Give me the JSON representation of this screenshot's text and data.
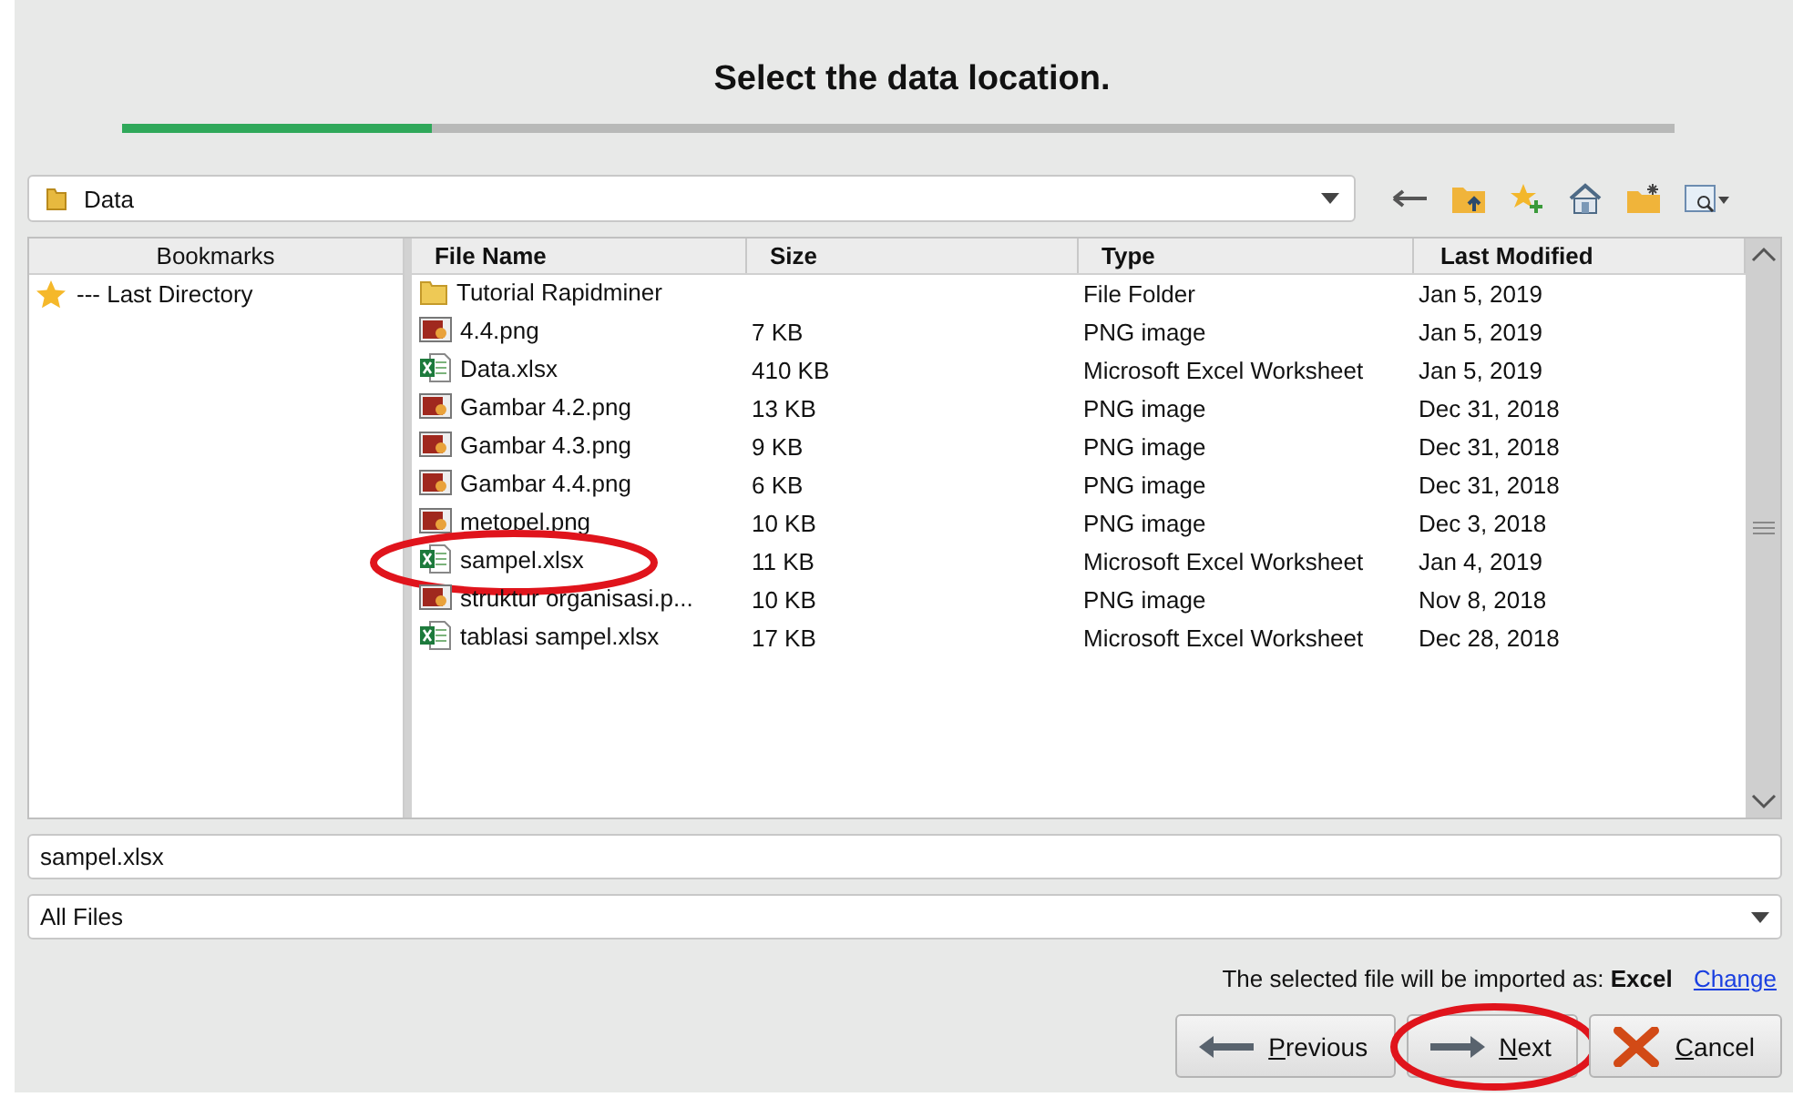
{
  "heading": "Select the data location.",
  "progress": {
    "level": 0.2
  },
  "location": {
    "value": "Data"
  },
  "bookmarks": {
    "header": "Bookmarks",
    "items": [
      {
        "label": "--- Last Directory"
      }
    ]
  },
  "files": {
    "columns": [
      "File Name",
      "Size",
      "Type",
      "Last Modified"
    ],
    "rows": [
      {
        "kind": "folder",
        "name": "Tutorial Rapidminer",
        "size": "",
        "type": "File Folder",
        "modified": "Jan 5, 2019",
        "circled": false
      },
      {
        "kind": "image",
        "name": "4.4.png",
        "size": "7 KB",
        "type": "PNG image",
        "modified": "Jan 5, 2019",
        "circled": false
      },
      {
        "kind": "excel",
        "name": "Data.xlsx",
        "size": "410 KB",
        "type": "Microsoft Excel Worksheet",
        "modified": "Jan 5, 2019",
        "circled": false
      },
      {
        "kind": "image",
        "name": "Gambar 4.2.png",
        "size": "13 KB",
        "type": "PNG image",
        "modified": "Dec 31, 2018",
        "circled": false
      },
      {
        "kind": "image",
        "name": "Gambar 4.3.png",
        "size": "9 KB",
        "type": "PNG image",
        "modified": "Dec 31, 2018",
        "circled": false
      },
      {
        "kind": "image",
        "name": "Gambar 4.4.png",
        "size": "6 KB",
        "type": "PNG image",
        "modified": "Dec 31, 2018",
        "circled": false
      },
      {
        "kind": "image",
        "name": "metopel.png",
        "size": "10 KB",
        "type": "PNG image",
        "modified": "Dec 3, 2018",
        "circled": false
      },
      {
        "kind": "excel",
        "name": "sampel.xlsx",
        "size": "11 KB",
        "type": "Microsoft Excel Worksheet",
        "modified": "Jan 4, 2019",
        "circled": true
      },
      {
        "kind": "image",
        "name": "struktur organisasi.p...",
        "size": "10 KB",
        "type": "PNG image",
        "modified": "Nov 8, 2018",
        "circled": false
      },
      {
        "kind": "excel",
        "name": "tablasi sampel.xlsx",
        "size": "17 KB",
        "type": "Microsoft Excel Worksheet",
        "modified": "Dec 28, 2018",
        "circled": false
      }
    ]
  },
  "filename": {
    "value": "sampel.xlsx"
  },
  "filter": {
    "value": "All Files"
  },
  "import_info": {
    "text": "The selected file will be imported as: **Excel**",
    "link": "Change"
  },
  "buttons": [
    {
      "kind": "previous",
      "label": "Previous",
      "circled": false
    },
    {
      "kind": "next",
      "label": "Next",
      "circled": true
    },
    {
      "kind": "cancel",
      "label": "Cancel",
      "circled": false
    }
  ]
}
